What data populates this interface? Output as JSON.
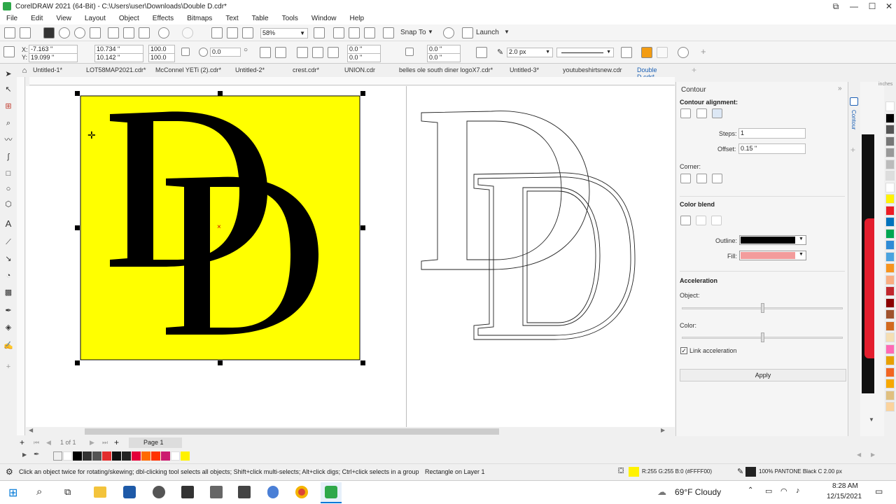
{
  "window": {
    "title": "CorelDRAW 2021 (64-Bit) - C:\\Users\\user\\Downloads\\Double D.cdr*",
    "controls": [
      "⧉",
      "—",
      "☐",
      "✕"
    ]
  },
  "menu": [
    "File",
    "Edit",
    "View",
    "Layout",
    "Object",
    "Effects",
    "Bitmaps",
    "Text",
    "Table",
    "Tools",
    "Window",
    "Help"
  ],
  "toolbar": {
    "zoom": "58%",
    "snap_to": "Snap To",
    "launch": "Launch"
  },
  "property_bar": {
    "x": "-7.163 \"",
    "y": "19.099 \"",
    "width": "10.734 \"",
    "height": "10.142 \"",
    "scale_x": "100.0",
    "scale_y": "100.0",
    "rotation": "0.0",
    "corner_1": "0.0 \"",
    "corner_2": "0.0 \"",
    "corner_3": "0.0 \"",
    "corner_4": "0.0 \"",
    "outline_width": "2.0 px"
  },
  "tabs": [
    {
      "label": "Untitled-1*"
    },
    {
      "label": "LOT58MAP2021.cdr*"
    },
    {
      "label": "McConnel YETi (2).cdr*"
    },
    {
      "label": "Untitled-2*"
    },
    {
      "label": "crest.cdr*"
    },
    {
      "label": "UNION.cdr"
    },
    {
      "label": "belles ole south diner logoX7.cdr*"
    },
    {
      "label": "Untitled-3*"
    },
    {
      "label": "youtubeshirtsnew.cdr"
    },
    {
      "label": "Double D.cdr*"
    }
  ],
  "ruler_unit": "inches",
  "docker": {
    "title": "Contour",
    "side_tab": "Contour",
    "alignment_label": "Contour alignment:",
    "steps_label": "Steps:",
    "steps_value": "1",
    "offset_label": "Offset:",
    "offset_value": "0.15 \"",
    "corner_label": "Corner:",
    "color_blend_label": "Color blend",
    "outline_label": "Outline:",
    "fill_label": "Fill:",
    "outline_color": "#000000",
    "fill_color": "#f39c9c",
    "acceleration_label": "Acceleration",
    "object_label": "Object:",
    "color_label": "Color:",
    "link_accel_label": "Link acceleration",
    "link_accel_checked": true,
    "apply_label": "Apply"
  },
  "page_nav": {
    "page_count": "1 of 1",
    "page_tab": "Page 1"
  },
  "palette_colors": [
    "#ffffff",
    "#000000",
    "#333333",
    "#555555",
    "#777777",
    "#999999",
    "#e32e2e",
    "#ff6a00",
    "#ff9900",
    "#e4003a",
    "#cc1b6f",
    "#ffffff",
    "#fff200"
  ],
  "vertical_palette_colors": [
    "#ffffff",
    "#000000",
    "#555555",
    "#777777",
    "#999999",
    "#bbbbbb",
    "#dddddd",
    "#ffffff",
    "#fff200",
    "#ed1c24",
    "#0072bc",
    "#00a651",
    "#2e8bd6",
    "#4aa3df",
    "#f7941d",
    "#f9ad81",
    "#c1272d",
    "#8b0000",
    "#a0522d",
    "#d2691e",
    "#f5deb3",
    "#ff69b4",
    "#e8a000",
    "#f26522",
    "#f7a800",
    "#e0c080",
    "#fbd39d"
  ],
  "status": {
    "hint": "Click an object twice for rotating/skewing; dbl-clicking tool selects all objects; Shift+click multi-selects; Alt+click digs; Ctrl+click selects in a group",
    "selection": "Rectangle on Layer 1",
    "fill_info": "R:255 G:255 B:0 (#FFFF00)",
    "fill_color": "#fff200",
    "outline_info": "100% PANTONE Black C  2.00 px"
  },
  "taskbar": {
    "weather": "69°F  Cloudy",
    "time": "8:28 AM",
    "date": "12/15/2021"
  },
  "artwork": {
    "background_color": "#ffff00",
    "letter": "D"
  }
}
